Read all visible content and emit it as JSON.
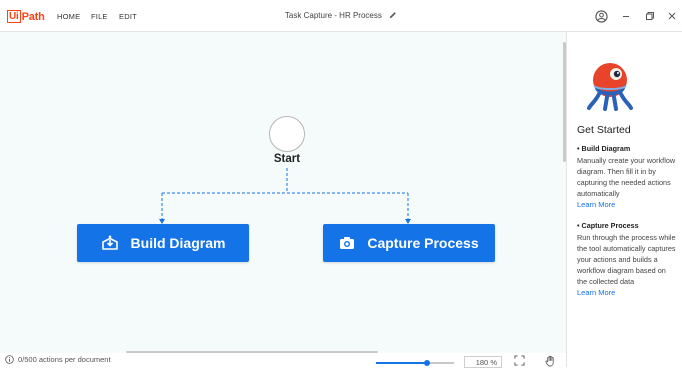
{
  "app": {
    "logo": {
      "boxed": "Ui",
      "rest": "Path"
    },
    "menu": [
      "HOME",
      "FILE",
      "EDIT"
    ],
    "title": "Task Capture - HR Process"
  },
  "canvas": {
    "start_label": "Start",
    "build_diagram_label": "Build Diagram",
    "capture_process_label": "Capture Process"
  },
  "panel": {
    "title": "Get Started",
    "build": {
      "heading": "• Build Diagram",
      "body": "Manually create your workflow diagram. Then fill it in by capturing the needed actions automatically",
      "link": "Learn More"
    },
    "capture": {
      "heading": "• Capture Process",
      "body": "Run through the process while the tool automatically captures your actions and builds a workflow diagram based on the collected data",
      "link": "Learn More"
    }
  },
  "status": {
    "actions": "0/500 actions per document",
    "zoom": "180 %",
    "zoom_slider_fraction": 0.65
  },
  "colors": {
    "accent": "#1473e6",
    "brand": "#fa4616",
    "canvas_bg": "#f5fbfb"
  },
  "icons": {
    "pencil": "pencil-icon",
    "account": "account-icon",
    "minimize": "minimize-icon",
    "restore": "restore-icon",
    "close": "close-icon",
    "build": "build-diagram-icon",
    "camera": "camera-icon",
    "info": "info-icon",
    "fit": "fit-screen-icon",
    "hand": "hand-pan-icon"
  }
}
